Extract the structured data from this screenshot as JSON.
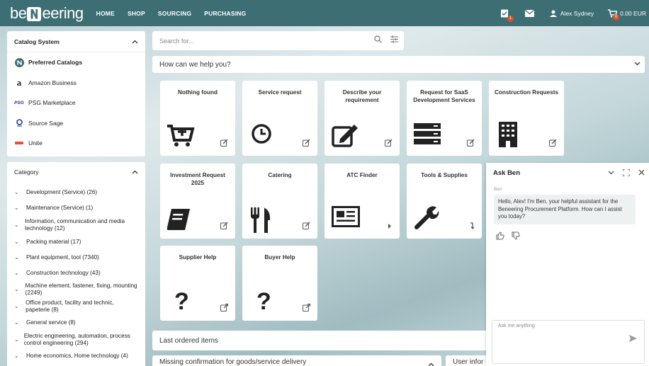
{
  "header": {
    "logo_text": "beNeering",
    "nav": [
      "HOME",
      "SHOP",
      "SOURCING",
      "PURCHASING"
    ],
    "user_name": "Alex Sydney",
    "cart_total": "0.00 EUR",
    "approvals_badge": "1",
    "cart_badge": "0"
  },
  "catalog_system": {
    "title": "Catalog System",
    "items": [
      {
        "label": "Preferred Catalogs",
        "icon": "beneering-logo-icon",
        "bold": true
      },
      {
        "label": "Amazon Business",
        "icon": "amazon-icon",
        "glyph": "a"
      },
      {
        "label": "PSG Marketplace",
        "icon": "psg-icon",
        "glyph": "PSG"
      },
      {
        "label": "Source Sage",
        "icon": "sourcesage-icon"
      },
      {
        "label": "Unite",
        "icon": "unite-icon"
      }
    ]
  },
  "category": {
    "title": "Category",
    "items": [
      "Development (Service) (26)",
      "Maintenance (Service) (1)",
      "Information, communication and media technology (12)",
      "Packing material (17)",
      "Plant equipment, tool (7340)",
      "Construction technology (43)",
      "Machine element, fastener, fixing, mounting (2249)",
      "Office product, facility and technic, papeterie (8)",
      "General service (8)",
      "Electric engineering, automation, process control engineering (294)",
      "Home economics, Home technology (4)"
    ]
  },
  "search": {
    "placeholder": "Search for..."
  },
  "help": {
    "title": "How can we help you?"
  },
  "tiles": [
    {
      "title": "Nothing found",
      "icon": "cart-add-icon",
      "status": "edit-icon"
    },
    {
      "title": "Service request",
      "icon": "clock-icon",
      "status": "edit-icon"
    },
    {
      "title": "Describe your requirement",
      "icon": "pencil-note-icon",
      "status": "edit-icon"
    },
    {
      "title": "Request for SaaS Development Services",
      "icon": "server-icon",
      "status": "edit-icon"
    },
    {
      "title": "Construction Requests",
      "icon": "building-icon",
      "status": "edit-icon"
    },
    {
      "title": "Investment Request 2025",
      "icon": "book-icon",
      "status": "edit-icon"
    },
    {
      "title": "Catering",
      "icon": "cutlery-icon",
      "status": "edit-icon"
    },
    {
      "title": "ATC Finder",
      "icon": "newspaper-icon",
      "status": "play-icon"
    },
    {
      "title": "Tools & Supplies",
      "icon": "wrench-icon",
      "status": "return-icon"
    },
    {
      "title": "Supplier Help",
      "icon": "question-icon",
      "status": "external-link-icon"
    },
    {
      "title": "Buyer Help",
      "icon": "question-icon",
      "status": "external-link-icon"
    }
  ],
  "last_ordered": {
    "title": "Last ordered items"
  },
  "missing_confirmation": {
    "title": "Missing confirmation for goods/service delivery"
  },
  "user_info": {
    "title": "User infor"
  },
  "chat": {
    "title": "Ask Ben",
    "sender": "Ben",
    "message": "Hello, Alex! I'm Ben, your helpful assistant for the Beneering Procurement Platform. How can I assist you today?",
    "input_placeholder": "Ask me anything"
  }
}
